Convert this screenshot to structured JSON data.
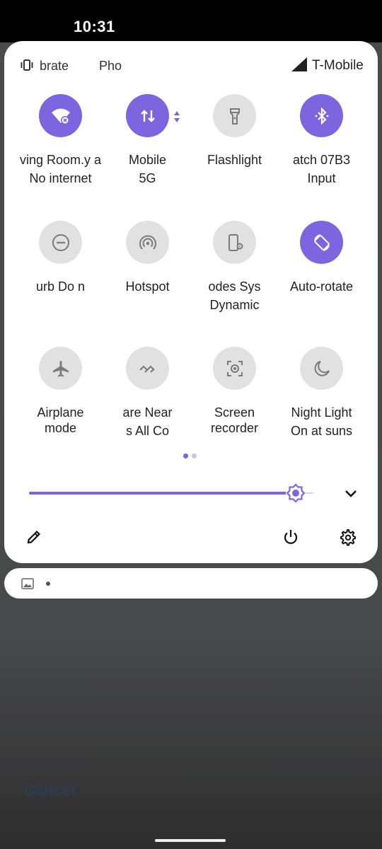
{
  "status_bar": {
    "time": "10:31"
  },
  "qs_header": {
    "vibrate_label": "brate",
    "phone_label": "Pho",
    "carrier": "T-Mobile"
  },
  "tiles": [
    {
      "label": "ving Room.y  a",
      "sub": "No internet",
      "icon": "wifi-off-icon",
      "state": "on"
    },
    {
      "label": "Mobile",
      "sub": "5G",
      "icon": "mobile-data-icon",
      "state": "on"
    },
    {
      "label": "Flashlight",
      "sub": "",
      "icon": "flashlight-icon",
      "state": "off"
    },
    {
      "label": "atch 07B3",
      "sub": "Input",
      "icon": "bluetooth-icon",
      "state": "on"
    },
    {
      "label": "urb     Do n",
      "sub": "",
      "icon": "do-not-disturb-icon",
      "state": "off"
    },
    {
      "label": "Hotspot",
      "sub": "",
      "icon": "hotspot-icon",
      "state": "off"
    },
    {
      "label": "odes     Sys",
      "sub": "Dynamic",
      "icon": "system-modes-icon",
      "state": "off"
    },
    {
      "label": "Auto-rotate",
      "sub": "",
      "icon": "auto-rotate-icon",
      "state": "on"
    },
    {
      "label": "Airplane",
      "sub": "mode",
      "icon": "airplane-icon",
      "state": "off"
    },
    {
      "label": "are      Near",
      "sub": "s      All Co",
      "icon": "nearby-share-icon",
      "state": "off"
    },
    {
      "label": "Screen",
      "sub": "recorder",
      "icon": "screen-recorder-icon",
      "state": "off"
    },
    {
      "label": "Night Light",
      "sub": "On at suns",
      "icon": "night-light-icon",
      "state": "off"
    }
  ],
  "pager": {
    "pages": 2,
    "current": 1
  },
  "brightness": {
    "level": 0.92
  },
  "notification": {
    "icon": "image-icon"
  },
  "bottom": {
    "cancel_label": "Cancel"
  },
  "colors": {
    "accent": "#7b66e0",
    "tile_off": "#e1e1e2",
    "panel": "#ffffff"
  }
}
